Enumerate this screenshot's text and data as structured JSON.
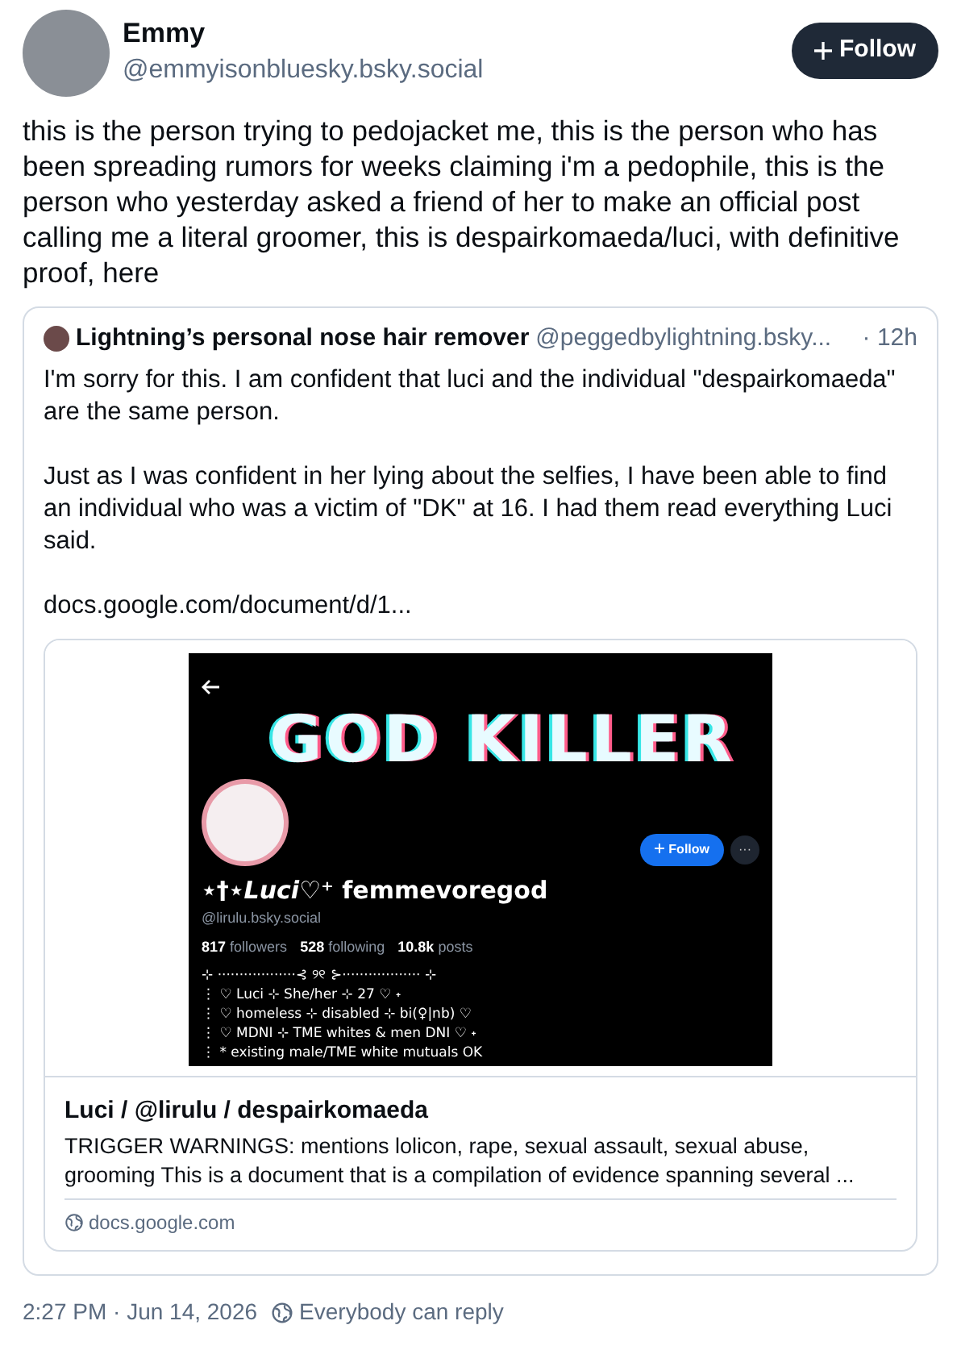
{
  "post": {
    "author": {
      "name": "Emmy",
      "handle": "@emmyisonbluesky.bsky.social"
    },
    "follow_button": "Follow",
    "text": "this is the person trying to pedojacket me, this is the person who has been spreading rumors for weeks claiming i'm a pedophile, this is the person who yesterday asked a friend of her to make an official post calling me a literal groomer, this is despairkomaeda/luci, with definitive proof, here",
    "quote": {
      "author_name": "Lightning’s personal nose hair remover",
      "handle": "@peggedbylightning.bsky...",
      "time": "· 12h",
      "paragraphs": [
        "I'm sorry for this. I am confident that luci and the individual \"despairkomaeda\" are the same person.",
        "Just as I was confident in her lying about the selfies, I have been able to find an individual who was a victim of \"DK\" at 16. I had them read everything Luci said.",
        "docs.google.com/document/d/1..."
      ],
      "link_card": {
        "screenshot": {
          "banner_text": "GOD KILLER",
          "follow_button": "Follow",
          "more_button": "···",
          "display_name": "⋆†⋆*Luci*♡⁺ femmevoregod",
          "handle": "@lirulu.bsky.social",
          "stats": [
            {
              "count": "817",
              "label": "followers"
            },
            {
              "count": "528",
              "label": "following"
            },
            {
              "count": "10.8k",
              "label": "posts"
            }
          ],
          "bio": [
            "⊹ ··················⊰ ୨୧ ⊱·················· ⊹",
            "⋮ ♡ Luci ⊹ She/her ⊹ 27 ♡ ˖",
            "⋮ ♡ homeless ⊹ disabled ⊹ bi(♀|nb) ♡",
            "⋮ ♡ MDNI ⊹ TME whites & men DNI ♡ ˖",
            "⋮ * existing male/TME white mutuals OK"
          ]
        },
        "title": "Luci / @lirulu / despairkomaeda",
        "description": "TRIGGER WARNINGS: mentions lolicon, rape, sexual assault, sexual abuse, grooming  This is a document that is a compilation of evidence spanning several ...",
        "domain": "docs.google.com"
      }
    },
    "footer": {
      "timestamp": "2:27 PM · Jun 14, 2026",
      "reply_setting": "Everybody can reply"
    }
  }
}
